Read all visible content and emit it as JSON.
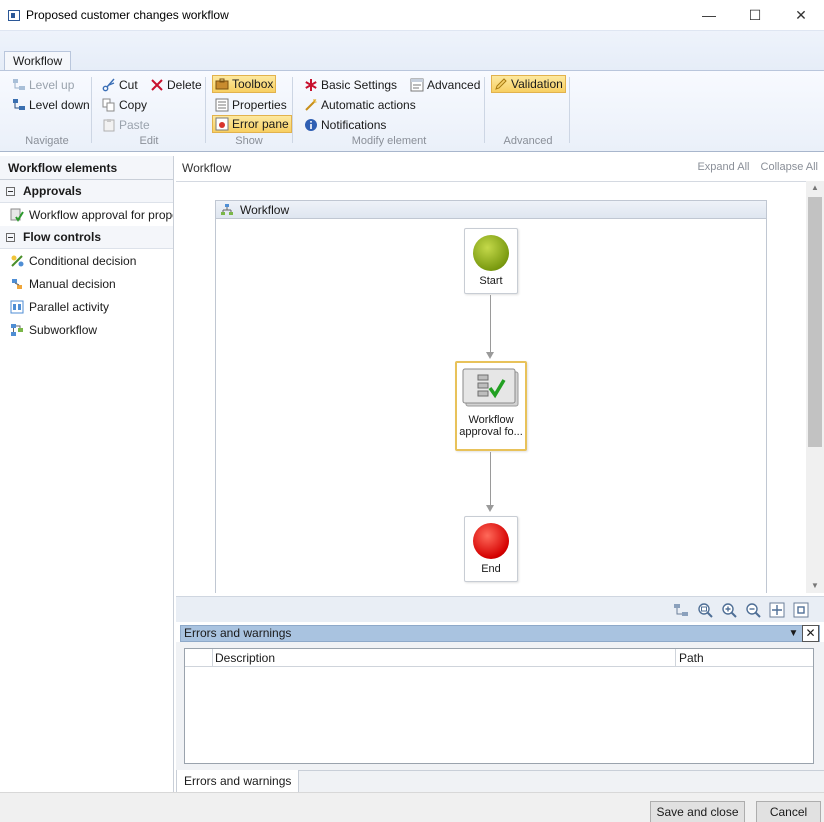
{
  "window": {
    "title": "Proposed customer changes workflow",
    "controls": {
      "minimize": "—",
      "maximize": "☐",
      "close": "✕"
    }
  },
  "ribbon": {
    "tab": "Workflow",
    "groups": {
      "navigate": {
        "label": "Navigate",
        "level_up": "Level up",
        "level_down": "Level down"
      },
      "edit": {
        "label": "Edit",
        "cut": "Cut",
        "copy": "Copy",
        "paste": "Paste",
        "delete": "Delete"
      },
      "show": {
        "label": "Show",
        "toolbox": "Toolbox",
        "properties": "Properties",
        "error_pane": "Error pane"
      },
      "modify": {
        "label": "Modify element",
        "basic_settings": "Basic Settings",
        "automatic_actions": "Automatic actions",
        "notifications": "Notifications",
        "advanced": "Advanced"
      },
      "advanced": {
        "label": "Advanced",
        "validation": "Validation"
      }
    }
  },
  "elements_panel": {
    "header": "Workflow elements",
    "groups": [
      {
        "label": "Approvals",
        "items": [
          "Workflow approval for propos"
        ]
      },
      {
        "label": "Flow controls",
        "items": [
          "Conditional decision",
          "Manual decision",
          "Parallel activity",
          "Subworkflow"
        ]
      }
    ]
  },
  "canvas": {
    "header": "Workflow",
    "expand_all": "Expand All",
    "collapse_all": "Collapse All",
    "frame_title": "Workflow",
    "nodes": {
      "start": "Start",
      "approval_line1": "Workflow",
      "approval_line2": "approval fo...",
      "end": "End"
    }
  },
  "errors": {
    "title": "Errors and warnings",
    "columns": [
      "Description",
      "Path"
    ],
    "tab": "Errors and warnings"
  },
  "footer": {
    "save_close": "Save and close",
    "cancel": "Cancel"
  },
  "colors": {
    "start_node": "#7a9a10",
    "end_node": "#d40000",
    "selected_border": "#e8c25a",
    "active_button": "#f7cf62",
    "error_header": "#a9c3e0"
  }
}
